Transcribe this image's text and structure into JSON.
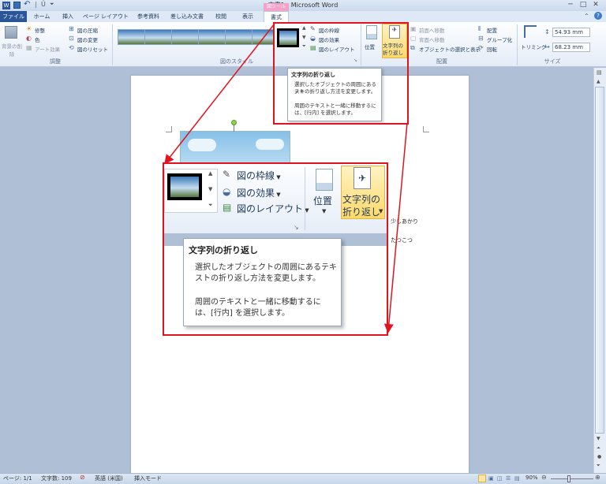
{
  "app": {
    "title": "文書1 - Microsoft Word",
    "context_tab_label": "図ツール",
    "window_minimize": "─",
    "window_maximize": "□",
    "window_close": "✕"
  },
  "tabs": [
    "ファイル",
    "ホーム",
    "挿入",
    "ページ レイアウト",
    "参考資料",
    "差し込み文書",
    "校閲",
    "表示",
    "書式"
  ],
  "ribbon": {
    "adjust": {
      "remove_bg": "背景の削除",
      "corrections": "修整",
      "color": "色",
      "art_effects": "アート効果",
      "compress": "図の圧縮",
      "change": "図の変更",
      "reset": "図のリセット",
      "group_label": "調整"
    },
    "styles": {
      "group_label": "図のスタイル",
      "border": "図の枠線",
      "effects": "図の効果",
      "layout": "図のレイアウト"
    },
    "arrange": {
      "position": "位置",
      "wrap_line1": "文字列の",
      "wrap_line2": "折り返し",
      "bring_forward": "前面へ移動",
      "send_backward": "背面へ移動",
      "selection_pane": "オブジェクトの選択と表示",
      "align": "配置",
      "group": "グループ化",
      "rotate": "回転",
      "group_label": "配置"
    },
    "size": {
      "crop": "トリミング",
      "height": "54.93 mm",
      "width": "68.23 mm",
      "group_label": "サイズ"
    }
  },
  "tooltip": {
    "title": "文字列の折り返し",
    "body1": "選択したオブジェクトの周囲にあるテキストの折り返し方法を変更します。",
    "body2": "周囲のテキストと一緒に移動するには、[行内] を選択します。",
    "small_body1_l1": "選択したオブジェクトの周囲にあるテキ",
    "small_body1_l2": "ストの折り返し方法を変更します。",
    "small_body2_l1": "周囲のテキストと一緒に移動するに",
    "small_body2_l2": "は、[行内] を選択します。",
    "big_body1_l1": "選択したオブジェクトの周囲にあるテキ",
    "big_body1_l2": "ストの折り返し方法を変更します。",
    "big_body2_l1": "周囲のテキストと一緒に移動するに",
    "big_body2_l2": "は、[行内] を選択します。"
  },
  "document": {
    "line1": "少しあかり",
    "line2": "たつこつ"
  },
  "status": {
    "page": "ページ: 1/1",
    "words": "文字数: 109",
    "language": "英語 (米国)",
    "mode": "挿入モード",
    "zoom": "90%"
  }
}
